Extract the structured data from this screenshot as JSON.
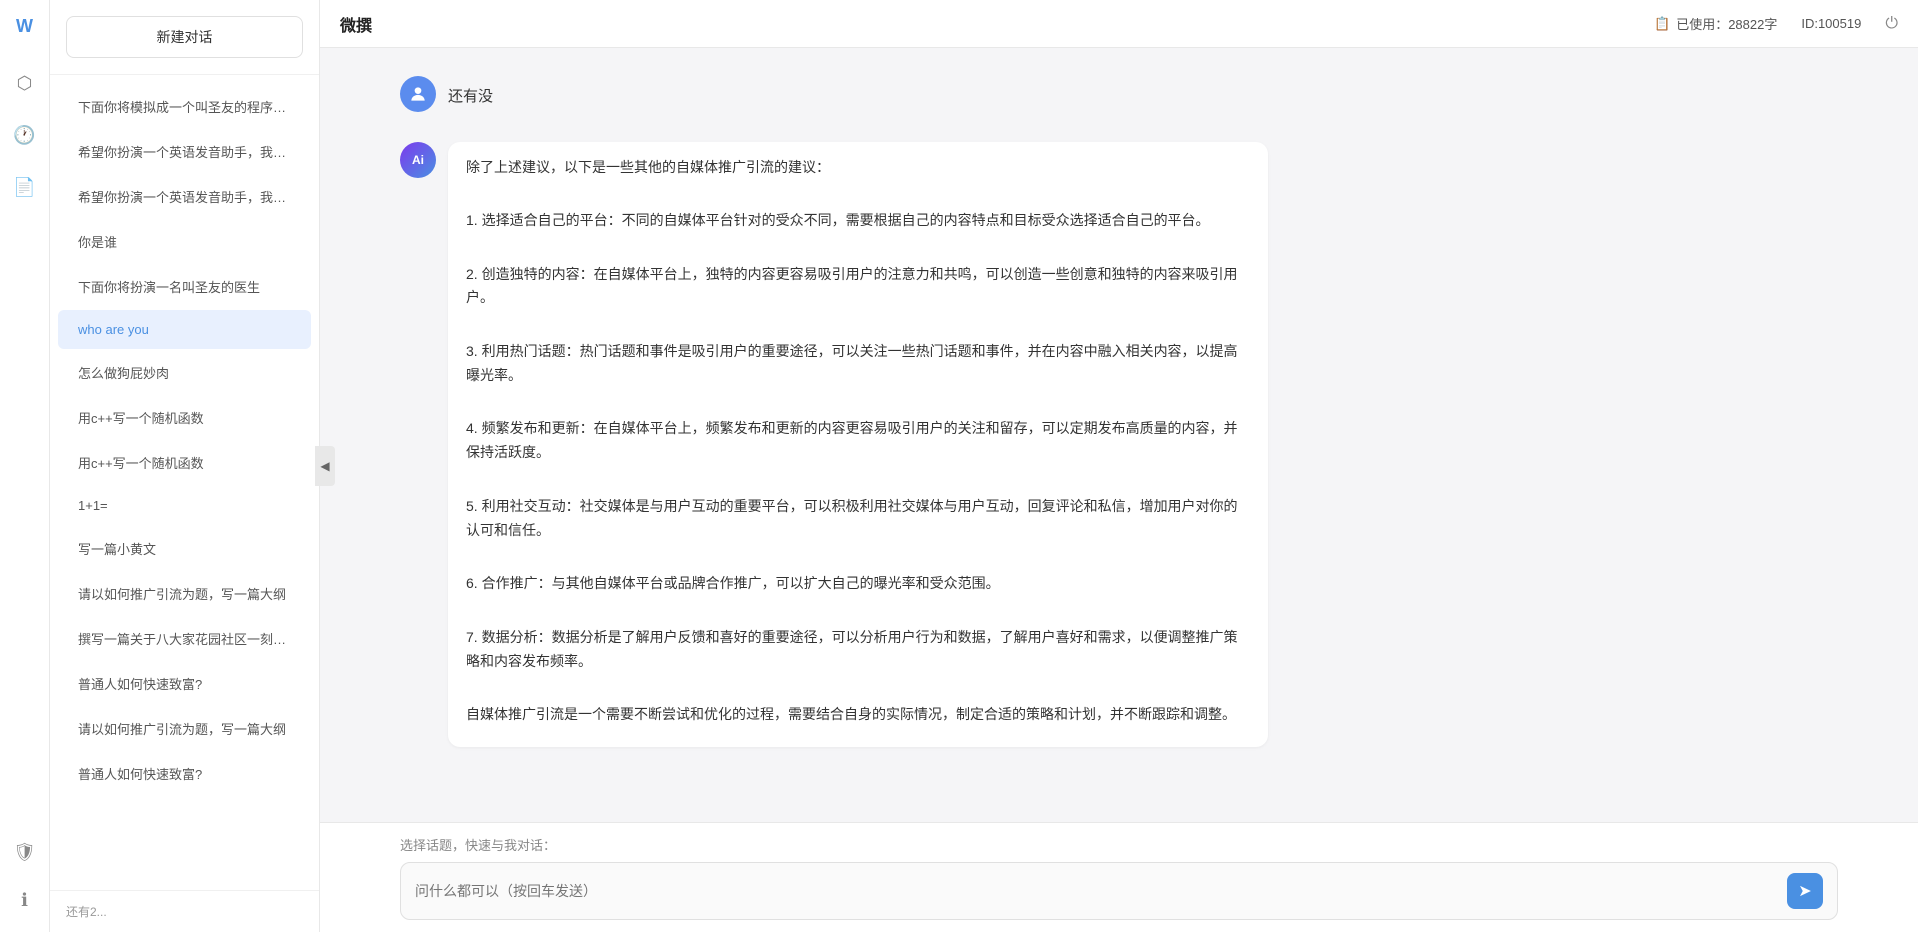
{
  "app": {
    "title": "微撰",
    "logo": "W"
  },
  "topbar": {
    "title": "微撰",
    "usage_label": "已使用：28822字",
    "usage_icon": "📋",
    "user_id": "ID:100519",
    "power_label": "⏻"
  },
  "sidebar": {
    "new_chat_label": "新建对话",
    "items": [
      {
        "id": 1,
        "text": "下面你将模拟成一个叫圣友的程序员，我说..."
      },
      {
        "id": 2,
        "text": "希望你扮演一个英语发音助手，我提供给你..."
      },
      {
        "id": 3,
        "text": "希望你扮演一个英语发音助手，我提供给你..."
      },
      {
        "id": 4,
        "text": "你是谁"
      },
      {
        "id": 5,
        "text": "下面你将扮演一名叫圣友的医生"
      },
      {
        "id": 6,
        "text": "who are you",
        "active": true
      },
      {
        "id": 7,
        "text": "怎么做狗屁妙肉"
      },
      {
        "id": 8,
        "text": "用c++写一个随机函数"
      },
      {
        "id": 9,
        "text": "用c++写一个随机函数"
      },
      {
        "id": 10,
        "text": "1+1="
      },
      {
        "id": 11,
        "text": "写一篇小黄文"
      },
      {
        "id": 12,
        "text": "请以如何推广引流为题，写一篇大纲"
      },
      {
        "id": 13,
        "text": "撰写一篇关于八大家花园社区一刻钟便民生..."
      },
      {
        "id": 14,
        "text": "普通人如何快速致富?"
      },
      {
        "id": 15,
        "text": "请以如何推广引流为题，写一篇大纲"
      },
      {
        "id": 16,
        "text": "普通人如何快速致富?"
      }
    ],
    "bottom_label": "还有2..."
  },
  "chat": {
    "messages": [
      {
        "id": 1,
        "role": "user",
        "avatar_label": "U",
        "text": "还有没"
      },
      {
        "id": 2,
        "role": "assistant",
        "avatar_label": "Ai",
        "text": "除了上述建议，以下是一些其他的自媒体推广引流的建议：\n\n1. 选择适合自己的平台：不同的自媒体平台针对的受众不同，需要根据自己的内容特点和目标受众选择适合自己的平台。\n\n2. 创造独特的内容：在自媒体平台上，独特的内容更容易吸引用户的注意力和共鸣，可以创造一些创意和独特的内容来吸引用户。\n\n3. 利用热门话题：热门话题和事件是吸引用户的重要途径，可以关注一些热门话题和事件，并在内容中融入相关内容，以提高曝光率。\n\n4. 频繁发布和更新：在自媒体平台上，频繁发布和更新的内容更容易吸引用户的关注和留存，可以定期发布高质量的内容，并保持活跃度。\n\n5. 利用社交互动：社交媒体是与用户互动的重要平台，可以积极利用社交媒体与用户互动，回复评论和私信，增加用户对你的认可和信任。\n\n6. 合作推广：与其他自媒体平台或品牌合作推广，可以扩大自己的曝光率和受众范围。\n\n7. 数据分析：数据分析是了解用户反馈和喜好的重要途径，可以分析用户行为和数据，了解用户喜好和需求，以便调整推广策略和内容发布频率。\n\n自媒体推广引流是一个需要不断尝试和优化的过程，需要结合自身的实际情况，制定合适的策略和计划，并不断跟踪和调整。"
      }
    ]
  },
  "input": {
    "quick_select_label": "选择话题，快速与我对话：",
    "placeholder": "问什么都可以（按回车发送）",
    "send_icon": "➤"
  },
  "nav_icons": [
    {
      "id": "home",
      "icon": "⬡",
      "active": false
    },
    {
      "id": "history",
      "icon": "🕐",
      "active": false
    },
    {
      "id": "docs",
      "icon": "📄",
      "active": false
    }
  ],
  "bottom_nav_icons": [
    {
      "id": "shield",
      "icon": "🛡",
      "active": false
    },
    {
      "id": "info",
      "icon": "ℹ",
      "active": false
    }
  ],
  "toggle_icon": "◀"
}
